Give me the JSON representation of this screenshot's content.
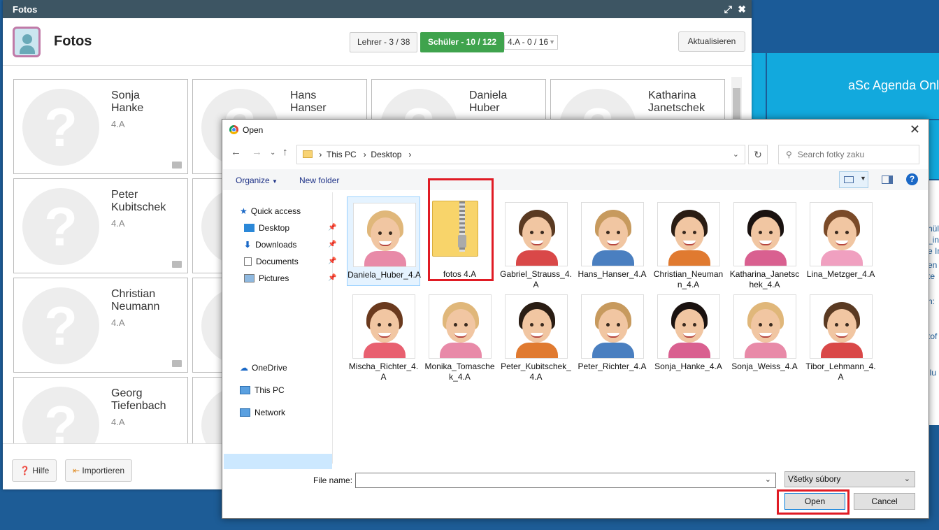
{
  "background": {
    "tile_text": "aSc Agenda Onl",
    "fragments": [
      "hül",
      "_in",
      "e In",
      "en",
      "te",
      "n:",
      "tof",
      "ilu"
    ]
  },
  "fotos": {
    "window_title": "Fotos",
    "heading": "Fotos",
    "tabs": {
      "teachers": "Lehrer - 3 / 38",
      "students": "Schüler - 10 / 122",
      "class_select": "4.A - 0 / 16"
    },
    "refresh_label": "Aktualisieren",
    "cards": [
      {
        "first": "Sonja",
        "last": "Hanke",
        "class": "4.A"
      },
      {
        "first": "Hans",
        "last": "Hanser",
        "class": ""
      },
      {
        "first": "Daniela",
        "last": "Huber",
        "class": ""
      },
      {
        "first": "Katharina",
        "last": "Janetschek",
        "class": ""
      },
      {
        "first": "Peter",
        "last": "Kubitschek",
        "class": "4.A"
      },
      {
        "first": "Christian",
        "last": "Neumann",
        "class": "4.A"
      },
      {
        "first": "Georg",
        "last": "Tiefenbach",
        "class": "4.A"
      }
    ],
    "placeholder_glyph": "?",
    "help_label": "Hilfe",
    "import_label": "Importieren"
  },
  "dialog": {
    "title": "Open",
    "breadcrumb": [
      "This PC",
      "Desktop"
    ],
    "search_placeholder": "Search fotky zaku",
    "organize_label": "Organize",
    "new_folder_label": "New folder",
    "nav": {
      "quick_access": "Quick access",
      "desktop": "Desktop",
      "downloads": "Downloads",
      "documents": "Documents",
      "pictures": "Pictures",
      "onedrive": "OneDrive",
      "this_pc": "This PC",
      "network": "Network"
    },
    "files": [
      {
        "name": "Daniela_Huber_4.A",
        "type": "photo",
        "hair": "#e0b77a",
        "shirt": "#e88aa8"
      },
      {
        "name": "fotos 4.A",
        "type": "zip"
      },
      {
        "name": "Gabriel_Strauss_4.A",
        "type": "photo",
        "hair": "#5a3a22",
        "shirt": "#d94848"
      },
      {
        "name": "Hans_Hanser_4.A",
        "type": "photo",
        "hair": "#c79a5e",
        "shirt": "#4a7fc0"
      },
      {
        "name": "Christian_Neumann_4.A",
        "type": "photo",
        "hair": "#2a1d14",
        "shirt": "#e07a30"
      },
      {
        "name": "Katharina_Janetschek_4.A",
        "type": "photo",
        "hair": "#1a1210",
        "shirt": "#d96090"
      },
      {
        "name": "Lina_Metzger_4.A",
        "type": "photo",
        "hair": "#7a4a28",
        "shirt": "#f0a0c0"
      },
      {
        "name": "Mischa_Richter_4.A",
        "type": "photo",
        "hair": "#6a3a1e",
        "shirt": "#e86070"
      },
      {
        "name": "Monika_Tomaschek_4.A",
        "type": "photo",
        "hair": "#e0b77a",
        "shirt": "#e88aa8"
      },
      {
        "name": "Peter_Kubitschek_4.A",
        "type": "photo",
        "hair": "#2a1d14",
        "shirt": "#e07a30"
      },
      {
        "name": "Peter_Richter_4.A",
        "type": "photo",
        "hair": "#c79a5e",
        "shirt": "#4a7fc0"
      },
      {
        "name": "Sonja_Hanke_4.A",
        "type": "photo",
        "hair": "#1a1210",
        "shirt": "#d96090"
      },
      {
        "name": "Sonja_Weiss_4.A",
        "type": "photo",
        "hair": "#e0b77a",
        "shirt": "#e88aa8"
      },
      {
        "name": "Tibor_Lehmann_4.A",
        "type": "photo",
        "hair": "#5a3a22",
        "shirt": "#d94848"
      }
    ],
    "file_name_label": "File name:",
    "file_name_value": "",
    "file_type": "Všetky súbory",
    "open_label": "Open",
    "cancel_label": "Cancel"
  }
}
